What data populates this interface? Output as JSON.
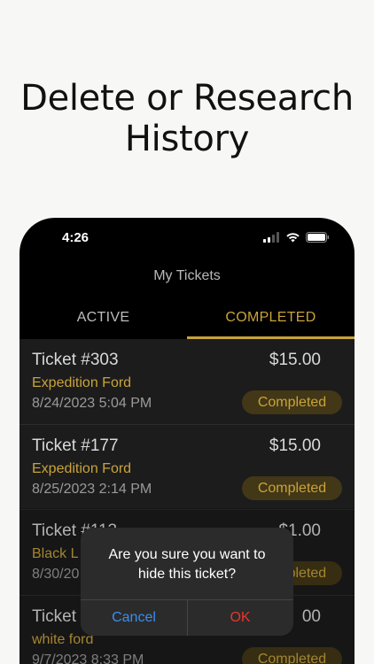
{
  "headline": {
    "line1": "Delete or Research",
    "line2": "History"
  },
  "status_bar": {
    "time": "4:26"
  },
  "nav": {
    "title": "My Tickets"
  },
  "tabs": [
    {
      "label": "ACTIVE",
      "selected": false
    },
    {
      "label": "COMPLETED",
      "selected": true
    }
  ],
  "tickets": [
    {
      "id": "Ticket #303",
      "price": "$15.00",
      "vehicle": "Expedition Ford",
      "date": "8/24/2023 5:04 PM",
      "status": "Completed"
    },
    {
      "id": "Ticket #177",
      "price": "$15.00",
      "vehicle": "Expedition Ford",
      "date": "8/25/2023 2:14 PM",
      "status": "Completed"
    },
    {
      "id": "Ticket #113",
      "price": "$1.00",
      "vehicle": "Black L",
      "date": "8/30/20",
      "status": "Completed"
    },
    {
      "id": "Ticket",
      "price": "00",
      "vehicle": "white ford",
      "date": "9/7/2023 8:33 PM",
      "status": "Completed"
    }
  ],
  "alert": {
    "message_line1": "Are you sure you want to",
    "message_line2": "hide this ticket?",
    "cancel_label": "Cancel",
    "ok_label": "OK"
  },
  "colors": {
    "accent": "#c9a33a",
    "cancel": "#3a8ef0",
    "ok": "#e5362b",
    "badge_bg": "#423716"
  }
}
